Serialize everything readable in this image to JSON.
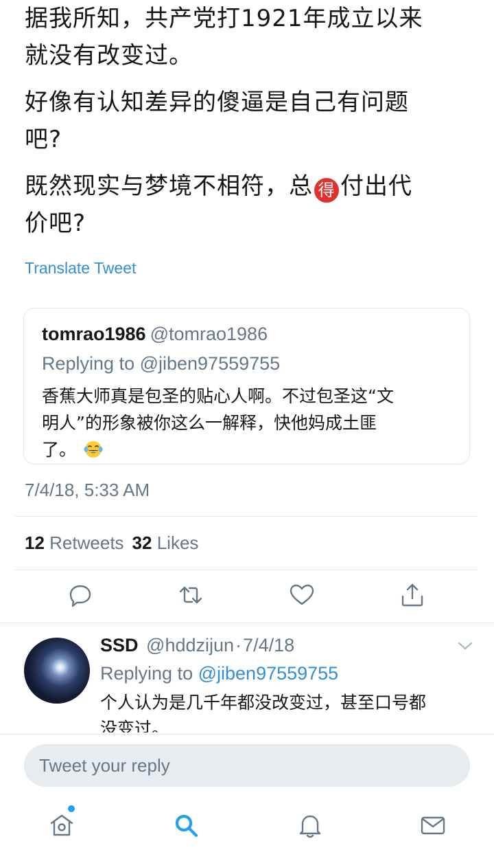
{
  "tweet": {
    "paragraphs": [
      {
        "lines": [
          "据我所知，共产党打1921年成立以来",
          "就没有改变过。"
        ]
      },
      {
        "lines": [
          "好像有认知差异的傻逼是自己有问题",
          "吧?"
        ]
      },
      {
        "line1_before": "既然现实与梦境不相符，总",
        "line1_emoji": "得",
        "line1_after": "付出代",
        "line2": "价吧?"
      }
    ],
    "translate_label": "Translate Tweet",
    "timestamp": "7/4/18, 5:33 AM",
    "retweets_count": "12",
    "retweets_label": "Retweets",
    "likes_count": "32",
    "likes_label": "Likes"
  },
  "quoted_tweet": {
    "name": "tomrao1986",
    "handle": "@tomrao1986",
    "replying_to": "Replying to @jiben97559755",
    "lines": [
      "香蕉大师真是包圣的贴心人啊。不过包圣这“文",
      "明人”的形象被你这么一解释，快他妈成土匪",
      "了。"
    ],
    "emoji": "tears-of-joy"
  },
  "reply": {
    "name": "SSD",
    "handle": "@hddzijun",
    "separator": "·",
    "date": "7/4/18",
    "replying_prefix": "Replying to",
    "replying_handle": "@jiben97559755",
    "lines": [
      "个人认为是几千年都没改变过，甚至口号都",
      "没变过。"
    ]
  },
  "reply_bar": {
    "placeholder": "Tweet your reply"
  },
  "icons": {
    "actions": [
      "reply-icon",
      "retweet-icon",
      "like-icon",
      "share-icon"
    ],
    "nav": [
      "home-icon",
      "search-icon",
      "notifications-icon",
      "messages-icon"
    ]
  },
  "colors": {
    "link": "#2f8ed8",
    "brand": "#1da1f2",
    "secondary_text": "#657786",
    "divider": "#e1e8ed"
  }
}
